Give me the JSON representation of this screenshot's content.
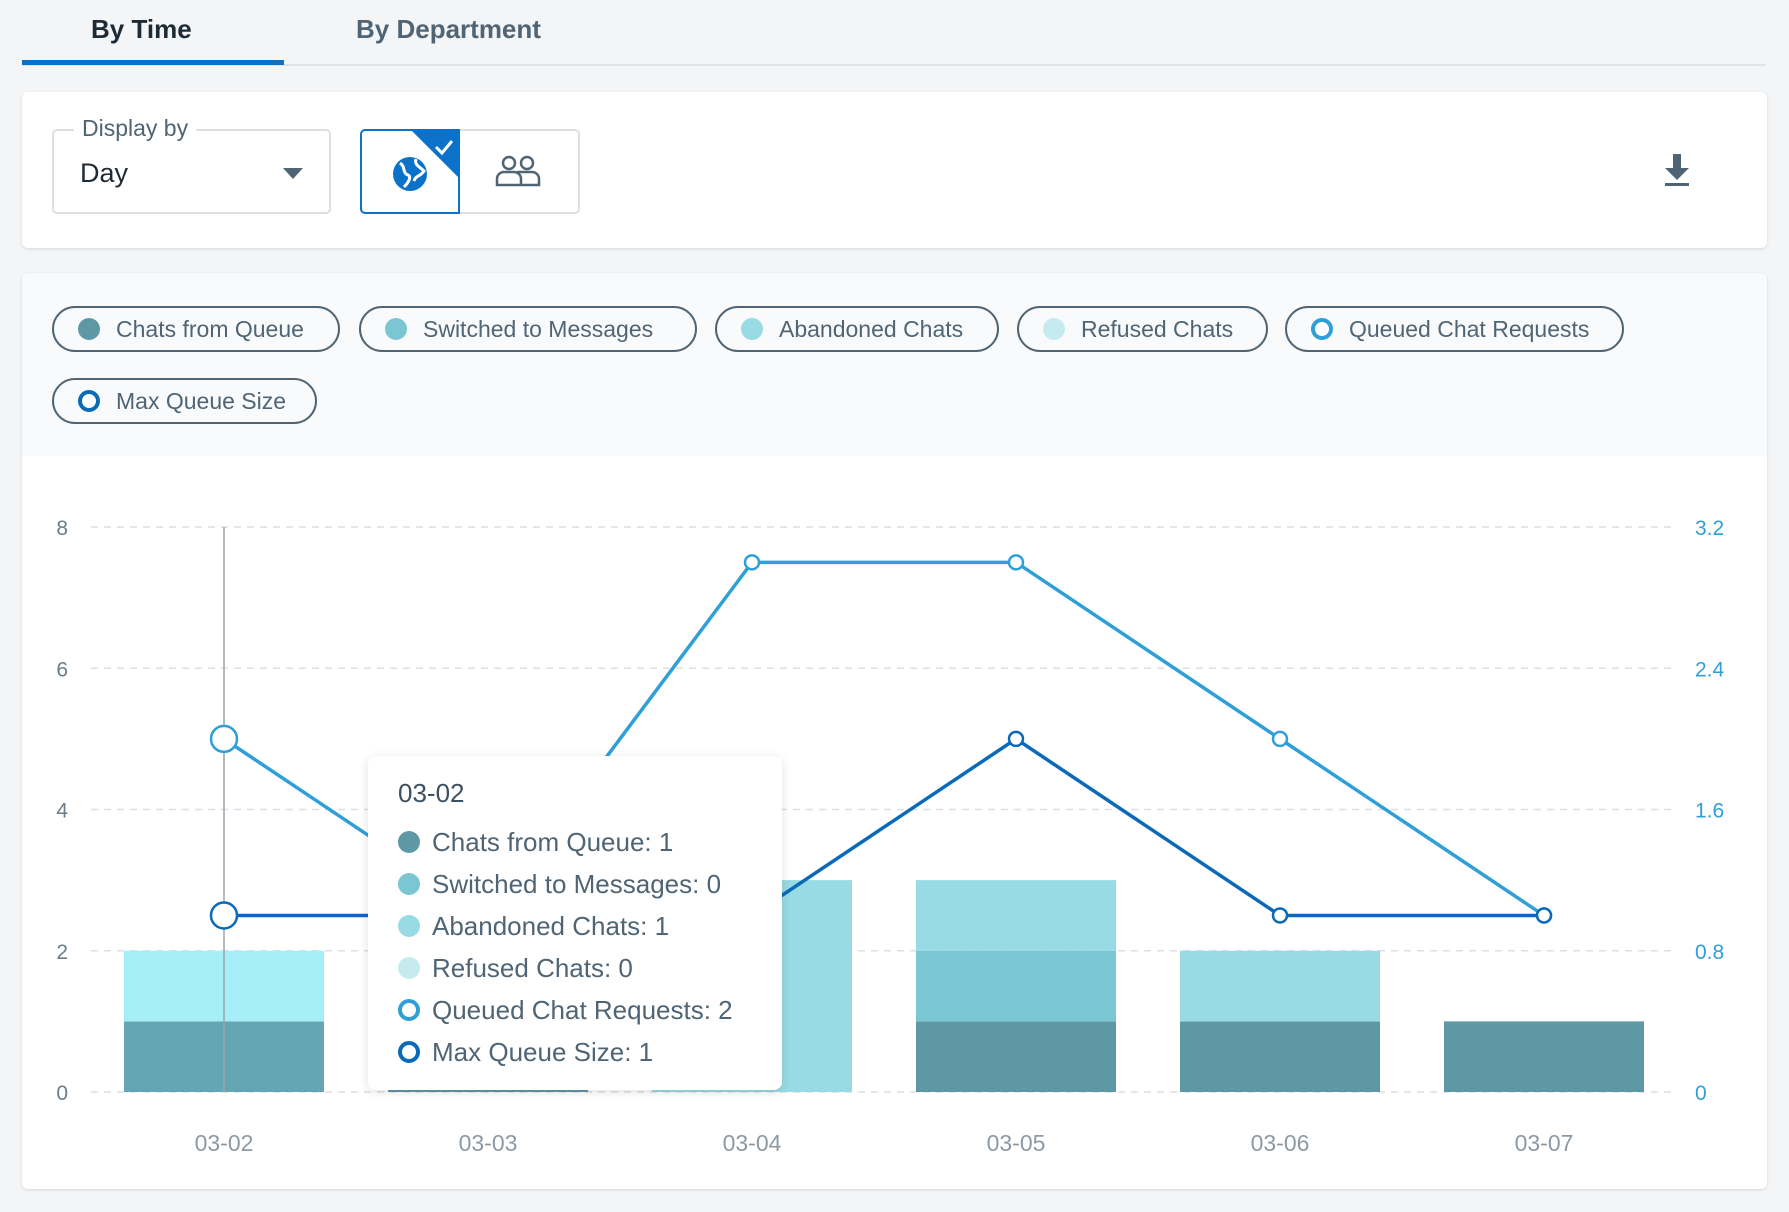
{
  "tabs": [
    {
      "label": "By Time",
      "active": true
    },
    {
      "label": "By Department",
      "active": false
    }
  ],
  "toolbar": {
    "display_by_label": "Display by",
    "display_by_value": "Day",
    "view_toggle": [
      {
        "icon": "globe-icon",
        "selected": true
      },
      {
        "icon": "users-icon",
        "selected": false
      }
    ],
    "download_icon": "download-icon"
  },
  "legend": [
    {
      "label": "Chats from Queue",
      "color": "#5e98a5",
      "style": "filled"
    },
    {
      "label": "Switched to Messages",
      "color": "#7bc6d3",
      "style": "filled"
    },
    {
      "label": "Abandoned Chats",
      "color": "#98dbe4",
      "style": "filled"
    },
    {
      "label": "Refused Chats",
      "color": "#c5eaf0",
      "style": "filled"
    },
    {
      "label": "Queued Chat Requests",
      "color": "#2f9fd8",
      "style": "ring"
    },
    {
      "label": "Max Queue Size",
      "color": "#0a6ab9",
      "style": "ring"
    }
  ],
  "chart_data": {
    "type": "bar",
    "categories": [
      "03-02",
      "03-03",
      "03-04",
      "03-05",
      "03-06",
      "03-07"
    ],
    "left_axis": {
      "ylim": [
        0,
        8
      ],
      "ticks": [
        "0",
        "2",
        "4",
        "6",
        "8"
      ]
    },
    "right_axis": {
      "ylim": [
        0,
        3.2
      ],
      "ticks": [
        "0",
        "0.8",
        "1.6",
        "2.4",
        "3.2"
      ]
    },
    "grid": true,
    "series": [
      {
        "name": "Chats from Queue",
        "kind": "stacked-bar",
        "axis": "left",
        "color": "#5e98a5",
        "values": [
          1,
          0,
          0,
          1,
          1,
          1
        ]
      },
      {
        "name": "Switched to Messages",
        "kind": "stacked-bar",
        "axis": "left",
        "color": "#7bc6d3",
        "values": [
          0,
          0,
          0,
          1,
          0,
          0
        ]
      },
      {
        "name": "Abandoned Chats",
        "kind": "stacked-bar",
        "axis": "left",
        "color": "#98dbe4",
        "values": [
          1,
          0,
          3,
          1,
          1,
          0
        ]
      },
      {
        "name": "Refused Chats",
        "kind": "stacked-bar",
        "axis": "left",
        "color": "#c5eaf0",
        "values": [
          0,
          0,
          0,
          0,
          0,
          0
        ]
      },
      {
        "name": "Queued Chat Requests",
        "kind": "line",
        "axis": "right",
        "color": "#2f9fd8",
        "values": [
          2,
          1,
          3,
          3,
          2,
          1
        ]
      },
      {
        "name": "Max Queue Size",
        "kind": "line",
        "axis": "right",
        "color": "#0a6ab9",
        "values": [
          1,
          1,
          1,
          2,
          1,
          1
        ]
      }
    ],
    "highlighted_category": "03-02"
  },
  "tooltip": {
    "date": "03-02",
    "rows": [
      {
        "text": "Chats from Queue: 1",
        "color": "#5e98a5",
        "style": "filled"
      },
      {
        "text": "Switched to Messages: 0",
        "color": "#7bc6d3",
        "style": "filled"
      },
      {
        "text": "Abandoned Chats: 1",
        "color": "#98dbe4",
        "style": "filled"
      },
      {
        "text": "Refused Chats: 0",
        "color": "#c5eaf0",
        "style": "filled"
      },
      {
        "text": "Queued Chat Requests: 2",
        "color": "#2f9fd8",
        "style": "ring"
      },
      {
        "text": "Max Queue Size: 1",
        "color": "#0a6ab9",
        "style": "ring"
      }
    ]
  }
}
